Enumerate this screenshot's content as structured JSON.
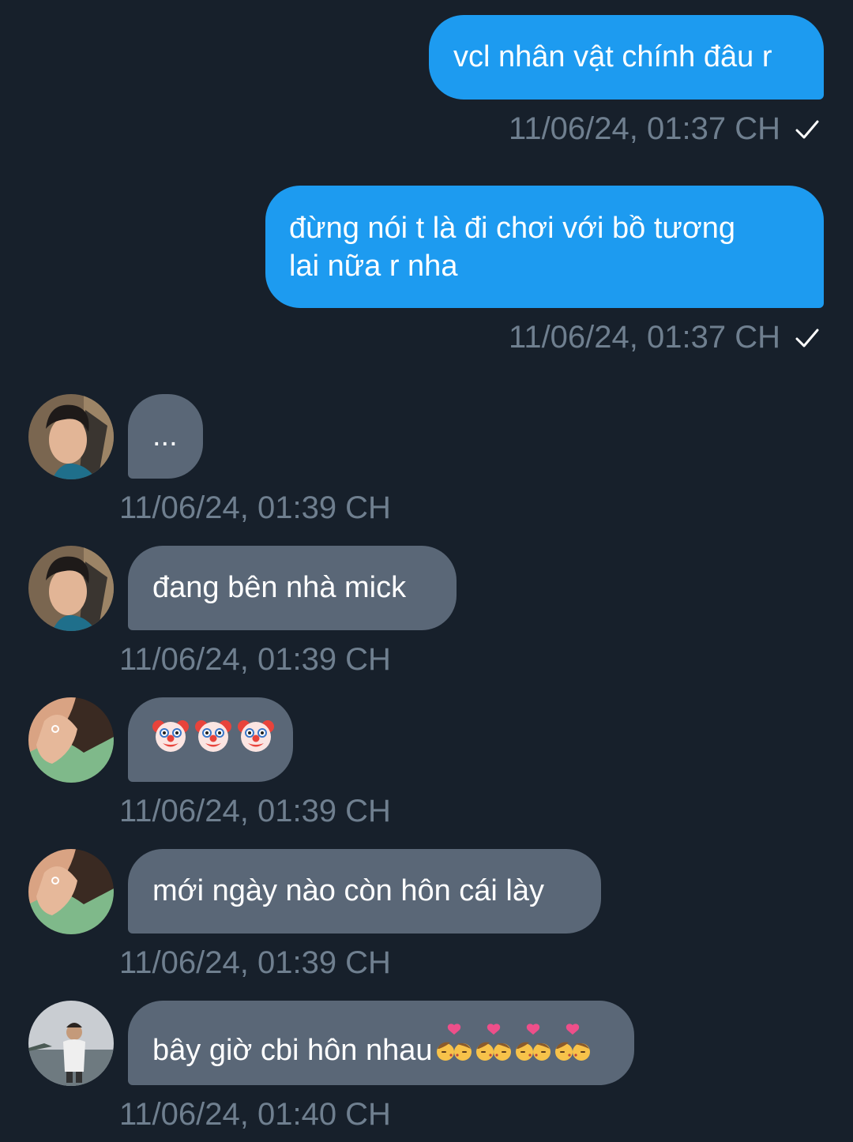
{
  "conversation": {
    "messages": [
      {
        "direction": "sent",
        "text": "vcl nhân vật chính đâu r",
        "time": "11/06/24, 01:37 CH",
        "read_check": "checkmark-icon"
      },
      {
        "direction": "sent",
        "text": "đừng nói t là đi chơi với bồ tương\nlai nữa r nha",
        "time": "11/06/24, 01:37 CH",
        "read_check": "checkmark-icon"
      },
      {
        "direction": "received",
        "sender_avatar": "avatar-boy-1",
        "text": "...",
        "time": "11/06/24, 01:39 CH"
      },
      {
        "direction": "received",
        "sender_avatar": "avatar-boy-1",
        "text": "đang bên nhà mick",
        "time": "11/06/24, 01:39 CH"
      },
      {
        "direction": "received",
        "sender_avatar": "avatar-girl-green",
        "emoji": [
          "clown-face-emoji",
          "clown-face-emoji",
          "clown-face-emoji"
        ],
        "time": "11/06/24, 01:39 CH"
      },
      {
        "direction": "received",
        "sender_avatar": "avatar-girl-green",
        "text": "mới ngày nào còn hôn cái lày",
        "time": "11/06/24, 01:39 CH"
      },
      {
        "direction": "received",
        "sender_avatar": "avatar-boy-lake",
        "text": "bây giờ cbi hôn nhau",
        "trailing_emoji": [
          "kiss-emoji",
          "kiss-emoji",
          "kiss-emoji",
          "kiss-emoji"
        ],
        "time": "11/06/24, 01:40 CH"
      }
    ]
  },
  "colors": {
    "background": "#17202b",
    "sent_bubble": "#1d9bf0",
    "received_bubble": "#5a6777",
    "timestamp": "#6f7f8f"
  }
}
